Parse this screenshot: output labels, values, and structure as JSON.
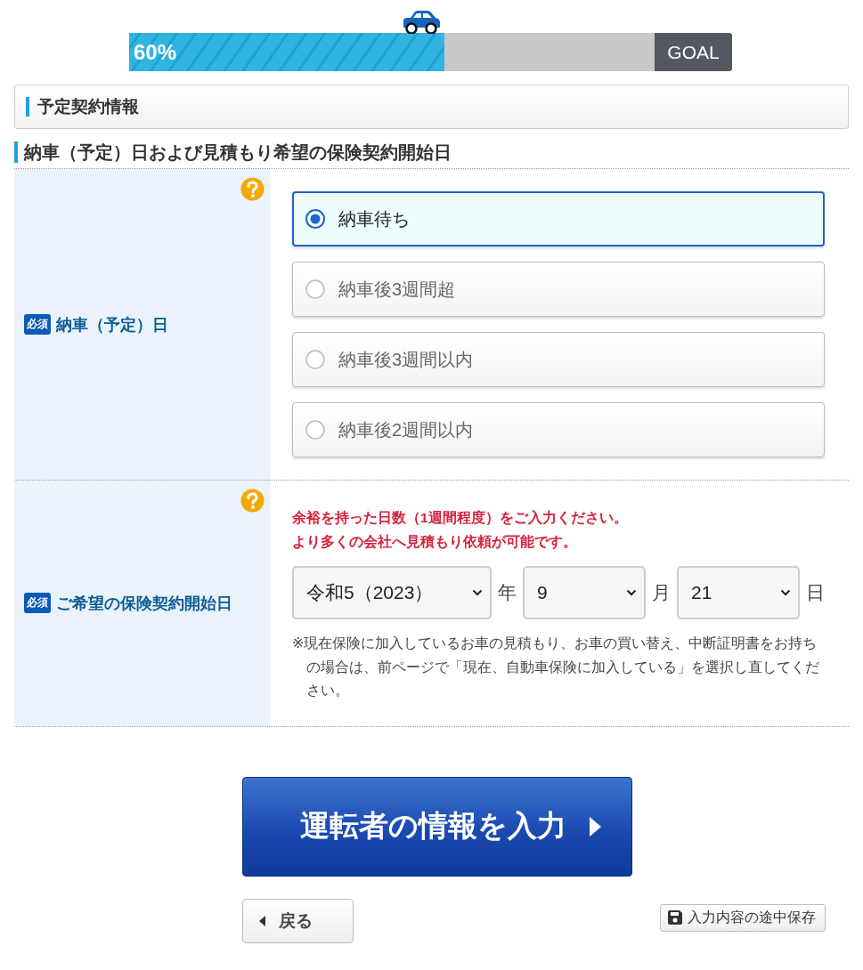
{
  "progress": {
    "label": "60%",
    "level": 0.6,
    "goal": "GOAL"
  },
  "section_title": "予定契約情報",
  "subsection_title": "納車（予定）日および見積もり希望の保険契約開始日",
  "fields": [
    {
      "kind": "radio",
      "required_badge": "必須",
      "label": "納車（予定）日",
      "options": [
        {
          "label": "納車待ち",
          "selected": true
        },
        {
          "label": "納車後3週間超",
          "selected": false
        },
        {
          "label": "納車後3週間以内",
          "selected": false
        },
        {
          "label": "納車後2週間以内",
          "selected": false
        }
      ]
    },
    {
      "kind": "date",
      "required_badge": "必須",
      "label": "ご希望の保険契約開始日",
      "notice": [
        "余裕を持った日数（1週間程度）をご入力ください。",
        "より多くの会社へ見積もり依頼が可能です。"
      ],
      "date_parts": [
        {
          "value": "令和5（2023）",
          "unit": "年"
        },
        {
          "value": "9",
          "unit": "月"
        },
        {
          "value": "21",
          "unit": "日"
        }
      ],
      "note": "※現在保険に加入しているお車の見積もり、お車の買い替え、中断証明書をお持ちの場合は、前ページで「現在、自動車保険に加入している」を選択し直してください。"
    }
  ],
  "next_button": "運転者の情報を入力",
  "back_button": "戻る",
  "save_button": "入力内容の途中保存"
}
